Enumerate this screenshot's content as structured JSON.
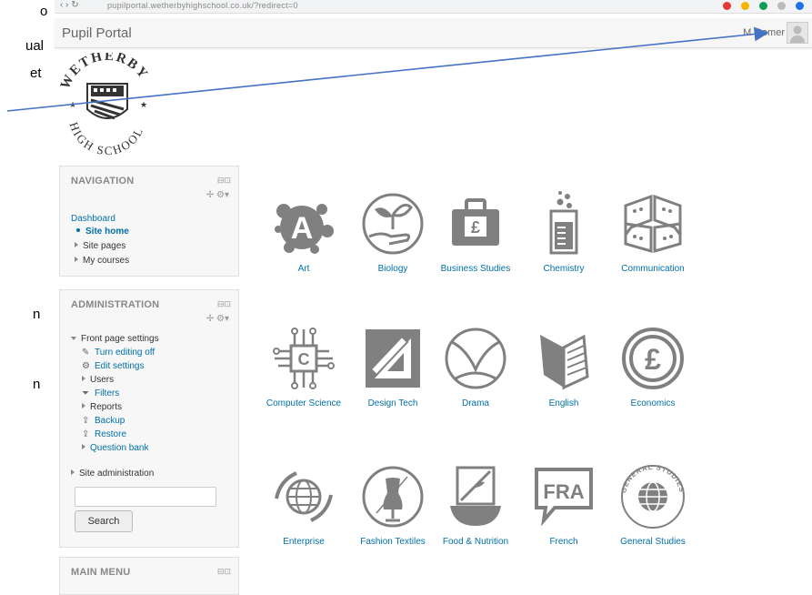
{
  "doc_fragments": [
    "o",
    "ual",
    "et",
    "n",
    "n"
  ],
  "browser": {
    "address": "pupilportal.wetherbyhighschool.co.uk/?redirect=0"
  },
  "header": {
    "brand": "Pupil Portal",
    "user_name": "M Gomer"
  },
  "logo": {
    "line1": "WETHERBY",
    "line2": "HIGH SCHOOL"
  },
  "navigation": {
    "title": "NAVIGATION",
    "dashboard": "Dashboard",
    "site_home": "Site home",
    "site_pages": "Site pages",
    "my_courses": "My courses"
  },
  "administration": {
    "title": "ADMINISTRATION",
    "front_page_settings": "Front page settings",
    "turn_editing_off": "Turn editing off",
    "edit_settings": "Edit settings",
    "users": "Users",
    "filters": "Filters",
    "reports": "Reports",
    "backup": "Backup",
    "restore": "Restore",
    "question_bank": "Question bank",
    "site_administration": "Site administration",
    "search_button": "Search"
  },
  "main_menu": {
    "title": "MAIN MENU"
  },
  "courses": {
    "art": "Art",
    "biology": "Biology",
    "business": "Business Studies",
    "chemistry": "Chemistry",
    "communication": "Communication",
    "computer_science": "Computer Science",
    "design_tech": "Design Tech",
    "drama": "Drama",
    "english": "English",
    "economics": "Economics",
    "enterprise": "Enterprise",
    "fashion": "Fashion Textiles",
    "food": "Food & Nutrition",
    "french": "French",
    "general_studies": "General Studies",
    "french_badge": "FRA",
    "gs_ring": "GENERAL STUDIES"
  },
  "colors": {
    "link": "#0070a8",
    "icon": "#808080",
    "arrow": "#4472c4"
  }
}
